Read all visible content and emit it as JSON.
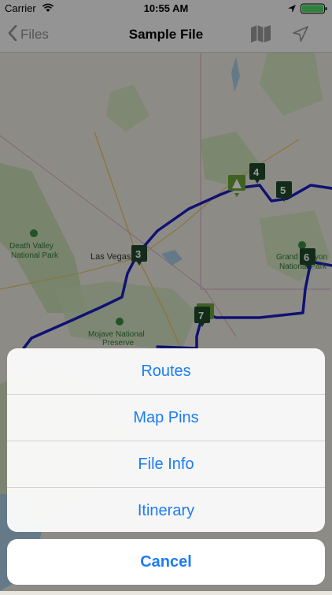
{
  "status_bar": {
    "carrier": "Carrier",
    "time": "10:55 AM"
  },
  "nav": {
    "back_label": "Files",
    "title": "Sample File",
    "map_icon": "map-icon",
    "locate_icon": "location-arrow-icon"
  },
  "map": {
    "labels": {
      "las_vegas": "Las Vegas",
      "death_valley_1": "Death Valley",
      "death_valley_2": "National Park",
      "grand_canyon_1": "Grand Canyon",
      "grand_canyon_2": "National Park",
      "mojave_1": "Mojave National",
      "mojave_2": "Preserve"
    },
    "pins": [
      {
        "number": "3"
      },
      {
        "number": "4"
      },
      {
        "number": "5"
      },
      {
        "number": "6"
      },
      {
        "number": "7"
      }
    ],
    "route_color": "#1a1fbf",
    "pin_color": "#1f4a2b",
    "campground_pin_color": "#6aa23a"
  },
  "action_sheet": {
    "items": [
      {
        "label": "Routes"
      },
      {
        "label": "Map Pins"
      },
      {
        "label": "File Info"
      },
      {
        "label": "Itinerary"
      }
    ],
    "cancel_label": "Cancel",
    "accent_color": "#1b7cf6"
  }
}
